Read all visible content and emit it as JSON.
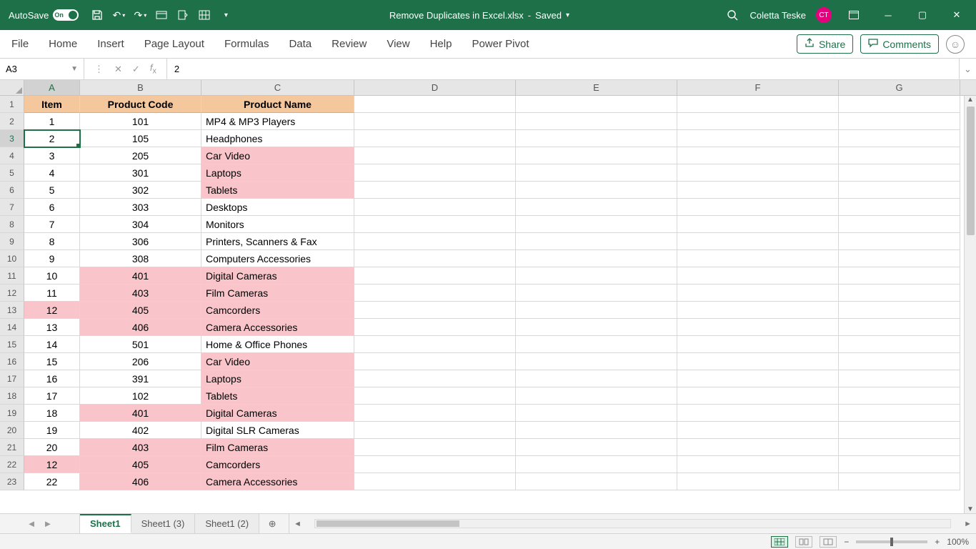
{
  "titlebar": {
    "autosave_label": "AutoSave",
    "autosave_state": "On",
    "doc_title": "Remove Duplicates in Excel.xlsx",
    "saved_state": "Saved",
    "user_name": "Coletta Teske",
    "user_initials": "CT"
  },
  "ribbon": {
    "tabs": [
      "File",
      "Home",
      "Insert",
      "Page Layout",
      "Formulas",
      "Data",
      "Review",
      "View",
      "Help",
      "Power Pivot"
    ],
    "share_label": "Share",
    "comments_label": "Comments"
  },
  "formula_bar": {
    "name_box": "A3",
    "formula": "2"
  },
  "grid": {
    "columns": [
      "A",
      "B",
      "C",
      "D",
      "E",
      "F",
      "G"
    ],
    "col_widths": {
      "A": 78,
      "B": 170,
      "C": 214,
      "D": 226,
      "E": 226,
      "F": 226,
      "G": 170
    },
    "active_col": "A",
    "active_row": 3,
    "selected_cell": "A3",
    "headers": {
      "A": "Item",
      "B": "Product Code",
      "C": "Product Name"
    },
    "rows": [
      {
        "n": 2,
        "A": "1",
        "B": "101",
        "C": "MP4 & MP3 Players",
        "hiA": false,
        "hiB": false,
        "hiC": false
      },
      {
        "n": 3,
        "A": "2",
        "B": "105",
        "C": "Headphones",
        "hiA": false,
        "hiB": false,
        "hiC": false
      },
      {
        "n": 4,
        "A": "3",
        "B": "205",
        "C": "Car Video",
        "hiA": false,
        "hiB": false,
        "hiC": true
      },
      {
        "n": 5,
        "A": "4",
        "B": "301",
        "C": "Laptops",
        "hiA": false,
        "hiB": false,
        "hiC": true
      },
      {
        "n": 6,
        "A": "5",
        "B": "302",
        "C": "Tablets",
        "hiA": false,
        "hiB": false,
        "hiC": true
      },
      {
        "n": 7,
        "A": "6",
        "B": "303",
        "C": "Desktops",
        "hiA": false,
        "hiB": false,
        "hiC": false
      },
      {
        "n": 8,
        "A": "7",
        "B": "304",
        "C": "Monitors",
        "hiA": false,
        "hiB": false,
        "hiC": false
      },
      {
        "n": 9,
        "A": "8",
        "B": "306",
        "C": "Printers, Scanners & Fax",
        "hiA": false,
        "hiB": false,
        "hiC": false
      },
      {
        "n": 10,
        "A": "9",
        "B": "308",
        "C": "Computers Accessories",
        "hiA": false,
        "hiB": false,
        "hiC": false
      },
      {
        "n": 11,
        "A": "10",
        "B": "401",
        "C": "Digital Cameras",
        "hiA": false,
        "hiB": true,
        "hiC": true
      },
      {
        "n": 12,
        "A": "11",
        "B": "403",
        "C": "Film Cameras",
        "hiA": false,
        "hiB": true,
        "hiC": true
      },
      {
        "n": 13,
        "A": "12",
        "B": "405",
        "C": "Camcorders",
        "hiA": true,
        "hiB": true,
        "hiC": true
      },
      {
        "n": 14,
        "A": "13",
        "B": "406",
        "C": "Camera Accessories",
        "hiA": false,
        "hiB": true,
        "hiC": true
      },
      {
        "n": 15,
        "A": "14",
        "B": "501",
        "C": "Home & Office Phones",
        "hiA": false,
        "hiB": false,
        "hiC": false
      },
      {
        "n": 16,
        "A": "15",
        "B": "206",
        "C": "Car Video",
        "hiA": false,
        "hiB": false,
        "hiC": true
      },
      {
        "n": 17,
        "A": "16",
        "B": "391",
        "C": "Laptops",
        "hiA": false,
        "hiB": false,
        "hiC": true
      },
      {
        "n": 18,
        "A": "17",
        "B": "102",
        "C": "Tablets",
        "hiA": false,
        "hiB": false,
        "hiC": true
      },
      {
        "n": 19,
        "A": "18",
        "B": "401",
        "C": "Digital Cameras",
        "hiA": false,
        "hiB": true,
        "hiC": true
      },
      {
        "n": 20,
        "A": "19",
        "B": "402",
        "C": "Digital SLR Cameras",
        "hiA": false,
        "hiB": false,
        "hiC": false
      },
      {
        "n": 21,
        "A": "20",
        "B": "403",
        "C": "Film Cameras",
        "hiA": false,
        "hiB": true,
        "hiC": true
      },
      {
        "n": 22,
        "A": "12",
        "B": "405",
        "C": "Camcorders",
        "hiA": true,
        "hiB": true,
        "hiC": true
      },
      {
        "n": 23,
        "A": "22",
        "B": "406",
        "C": "Camera Accessories",
        "hiA": false,
        "hiB": true,
        "hiC": true
      }
    ]
  },
  "sheets": {
    "tabs": [
      "Sheet1",
      "Sheet1 (3)",
      "Sheet1 (2)"
    ],
    "active": 0
  },
  "status": {
    "zoom": "100%"
  }
}
